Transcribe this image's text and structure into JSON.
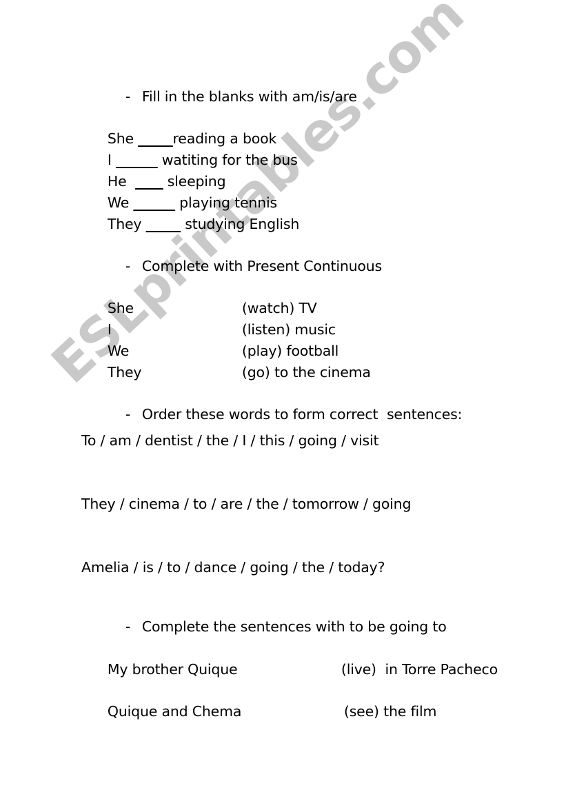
{
  "document": {
    "type": "esl-worksheet",
    "title": "Present Continuous and Going To worksheet",
    "background_color": "#ffffff",
    "text_color": "#000000"
  },
  "watermark": {
    "text": "ESLprintables.com",
    "color": "#c9c9c9",
    "rotation_deg": -43
  },
  "sections": [
    {
      "heading": "Fill in the blanks with am/is/are",
      "dash": "-",
      "lines": [
        {
          "subject": "She ",
          "blank": "_____",
          "rest": "reading a book"
        },
        {
          "subject": "I ",
          "blank": "______",
          "rest": " watiting for the bus"
        },
        {
          "subject": "He  ",
          "blank": "____",
          "rest": " sleeping"
        },
        {
          "subject": "We ",
          "blank": "______",
          "rest": " playing tennis"
        },
        {
          "subject": "They ",
          "blank": "_____",
          "rest": " studying English"
        }
      ]
    },
    {
      "heading": "Complete with Present Continuous",
      "dash": "-",
      "rows": [
        {
          "subject": "She",
          "prompt": "(watch) TV"
        },
        {
          "subject": "I",
          "prompt": "(listen) music"
        },
        {
          "subject": "We",
          "prompt": "(play) football"
        },
        {
          "subject": "They",
          "prompt": "(go) to the cinema"
        }
      ]
    },
    {
      "heading": "Order these words to form correct  sentences:",
      "dash": "-",
      "scrambles": [
        "To / am / dentist / the / I / this / going / visit",
        "They / cinema / to / are / the / tomorrow / going",
        "Amelia / is / to / dance / going / the / today?"
      ]
    },
    {
      "heading": "Complete the sentences with to be going to",
      "dash": "-",
      "rows": [
        {
          "subject": "My brother Quique",
          "prompt": "(live)  in Torre Pacheco"
        },
        {
          "subject": "Quique and Chema",
          "prompt": "(see) the film"
        }
      ]
    }
  ]
}
